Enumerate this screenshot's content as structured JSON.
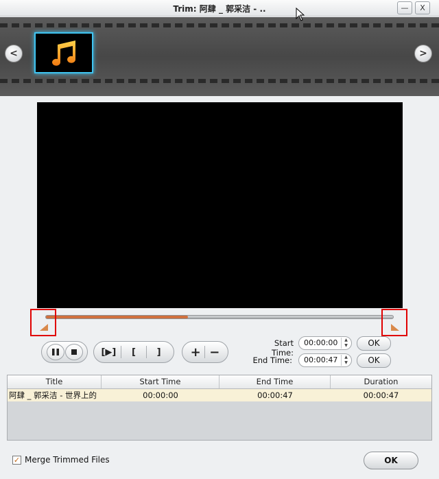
{
  "window": {
    "title": "Trim: 阿肆 _ 郭采洁 - ..",
    "min_label": "—",
    "close_label": "X"
  },
  "filmstrip": {
    "prev_label": "<",
    "next_label": ">",
    "thumb_icon": "music-note-icon"
  },
  "slider": {
    "progress_fraction": 0.41
  },
  "playback": {
    "pause_icon": "pause-icon",
    "stop_icon": "stop-icon",
    "play_segment_label": "[▶]",
    "mark_start_label": "[",
    "mark_end_label": "]",
    "add_label": "+",
    "remove_label": "−"
  },
  "times": {
    "start_label": "Start Time:",
    "start_value": "00:00:00",
    "end_label": "End Time:",
    "end_value": "00:00:47",
    "ok_label": "OK"
  },
  "table": {
    "columns": [
      "Title",
      "Start Time",
      "End Time",
      "Duration"
    ],
    "rows": [
      {
        "title": "阿肆 _ 郭采洁 - 世界上的",
        "start": "00:00:00",
        "end": "00:00:47",
        "duration": "00:00:47"
      }
    ]
  },
  "footer": {
    "merge_label": "Merge Trimmed Files",
    "merge_checked": true,
    "ok_label": "OK"
  },
  "colors": {
    "accent": "#d0703e",
    "thumb_glow": "#3fc3f0",
    "marker_highlight": "#e00000"
  }
}
